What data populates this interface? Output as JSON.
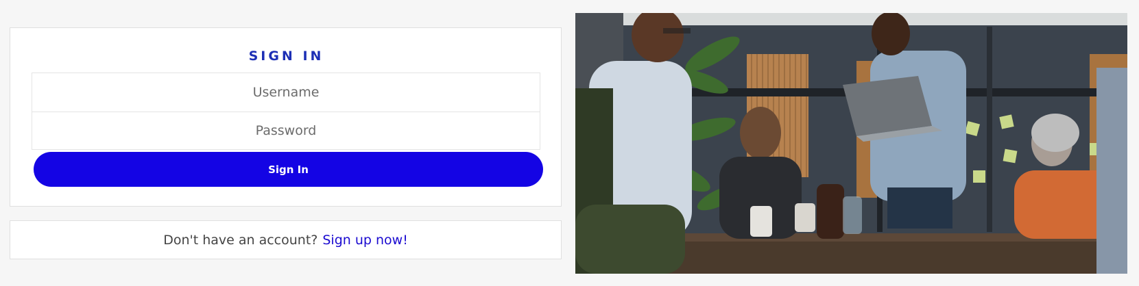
{
  "signin": {
    "title": "SIGN IN",
    "username_placeholder": "Username",
    "password_placeholder": "Password",
    "button_label": "Sign In"
  },
  "signup": {
    "prompt": "Don't have an account?",
    "link_label": "Sign up now!"
  },
  "colors": {
    "title": "#1d2fb5",
    "button": "#1404e4",
    "link": "#1a0ad0",
    "background": "#f6f6f6"
  }
}
